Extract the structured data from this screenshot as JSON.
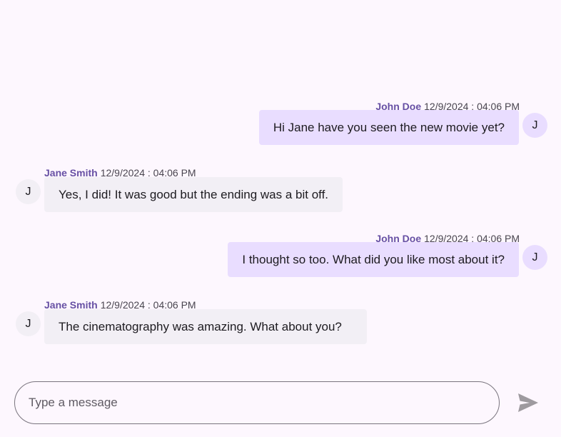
{
  "messages": [
    {
      "direction": "outgoing",
      "author": "John Doe",
      "time": "12/9/2024 : 04:06 PM",
      "text": "Hi Jane have you seen the new movie yet?",
      "avatar_initial": "J"
    },
    {
      "direction": "incoming",
      "author": "Jane Smith",
      "time": "12/9/2024 : 04:06 PM",
      "text": "Yes, I did! It was good but the ending was a bit off.",
      "avatar_initial": "J"
    },
    {
      "direction": "outgoing",
      "author": "John Doe",
      "time": "12/9/2024 : 04:06 PM",
      "text": "I thought so too. What did you like most about it?",
      "avatar_initial": "J"
    },
    {
      "direction": "incoming",
      "author": "Jane Smith",
      "time": "12/9/2024 : 04:06 PM",
      "text": "The cinematography was amazing. What about you?",
      "avatar_initial": "J"
    }
  ],
  "composer": {
    "placeholder": "Type a message",
    "value": ""
  },
  "icons": {
    "send": "send-icon"
  },
  "colors": {
    "background": "#fdf7fe",
    "accent": "#6750a4",
    "outgoing_bubble": "#e9ddff",
    "incoming_bubble": "#f2eff5",
    "send_icon": "#9e9a9f"
  }
}
